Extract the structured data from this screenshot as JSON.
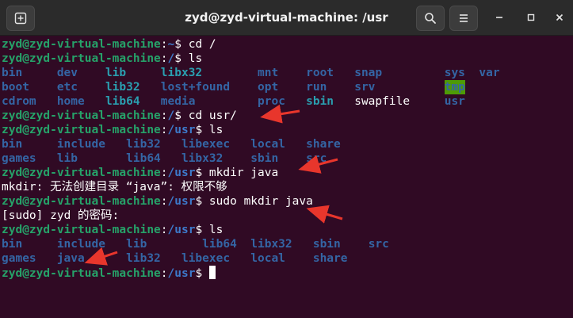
{
  "window": {
    "title": "zyd@zyd-virtual-machine: /usr"
  },
  "colors": {
    "background": "#300a24",
    "prompt_user": "#26a269",
    "prompt_path": "#3d7acb",
    "directory": "#3465a4",
    "directory_cyan": "#2a9fb0",
    "highlight_bg": "#4e9a06",
    "arrow": "#e8362c"
  },
  "terminal": {
    "prompt_user": "zyd@zyd-virtual-machine",
    "prompt_colon": ":",
    "dollar": "$",
    "lines": [
      {
        "type": "prompt",
        "path": "~",
        "command": "cd /"
      },
      {
        "type": "prompt",
        "path": "/",
        "command": "ls"
      },
      {
        "type": "listing",
        "cells": [
          {
            "text": "bin",
            "col": 0,
            "style": "dir"
          },
          {
            "text": "dev",
            "col": 8,
            "style": "dir"
          },
          {
            "text": "lib",
            "col": 15,
            "style": "dir-cyan"
          },
          {
            "text": "libx32",
            "col": 23,
            "style": "dir-cyan"
          },
          {
            "text": "mnt",
            "col": 37,
            "style": "dir"
          },
          {
            "text": "root",
            "col": 44,
            "style": "dir"
          },
          {
            "text": "snap",
            "col": 51,
            "style": "dir"
          },
          {
            "text": "sys",
            "col": 64,
            "style": "dir"
          },
          {
            "text": "var",
            "col": 69,
            "style": "dir"
          }
        ]
      },
      {
        "type": "listing",
        "cells": [
          {
            "text": "boot",
            "col": 0,
            "style": "dir"
          },
          {
            "text": "etc",
            "col": 8,
            "style": "dir"
          },
          {
            "text": "lib32",
            "col": 15,
            "style": "dir-cyan"
          },
          {
            "text": "lost+found",
            "col": 23,
            "style": "dir"
          },
          {
            "text": "opt",
            "col": 37,
            "style": "dir"
          },
          {
            "text": "run",
            "col": 44,
            "style": "dir"
          },
          {
            "text": "srv",
            "col": 51,
            "style": "dir"
          },
          {
            "text": "tmp",
            "col": 64,
            "style": "tmp"
          }
        ]
      },
      {
        "type": "listing",
        "cells": [
          {
            "text": "cdrom",
            "col": 0,
            "style": "dir"
          },
          {
            "text": "home",
            "col": 8,
            "style": "dir"
          },
          {
            "text": "lib64",
            "col": 15,
            "style": "dir-cyan"
          },
          {
            "text": "media",
            "col": 23,
            "style": "dir"
          },
          {
            "text": "proc",
            "col": 37,
            "style": "dir"
          },
          {
            "text": "sbin",
            "col": 44,
            "style": "dir-cyan"
          },
          {
            "text": "swapfile",
            "col": 51,
            "style": "plain"
          },
          {
            "text": "usr",
            "col": 64,
            "style": "dir"
          }
        ]
      },
      {
        "type": "prompt",
        "path": "/",
        "command": "cd usr/"
      },
      {
        "type": "prompt",
        "path": "/usr",
        "command": "ls"
      },
      {
        "type": "listing",
        "cells": [
          {
            "text": "bin",
            "col": 0,
            "style": "dir"
          },
          {
            "text": "include",
            "col": 8,
            "style": "dir"
          },
          {
            "text": "lib32",
            "col": 18,
            "style": "dir"
          },
          {
            "text": "libexec",
            "col": 26,
            "style": "dir"
          },
          {
            "text": "local",
            "col": 36,
            "style": "dir"
          },
          {
            "text": "share",
            "col": 44,
            "style": "dir"
          }
        ]
      },
      {
        "type": "listing",
        "cells": [
          {
            "text": "games",
            "col": 0,
            "style": "dir"
          },
          {
            "text": "lib",
            "col": 8,
            "style": "dir"
          },
          {
            "text": "lib64",
            "col": 18,
            "style": "dir"
          },
          {
            "text": "libx32",
            "col": 26,
            "style": "dir"
          },
          {
            "text": "sbin",
            "col": 36,
            "style": "dir"
          },
          {
            "text": "src",
            "col": 44,
            "style": "dir"
          }
        ]
      },
      {
        "type": "prompt",
        "path": "/usr",
        "command": "mkdir java"
      },
      {
        "type": "text",
        "text": "mkdir: 无法创建目录 “java”: 权限不够"
      },
      {
        "type": "prompt",
        "path": "/usr",
        "command": "sudo mkdir java"
      },
      {
        "type": "text",
        "text": "[sudo] zyd 的密码:"
      },
      {
        "type": "prompt",
        "path": "/usr",
        "command": "ls"
      },
      {
        "type": "listing",
        "cells": [
          {
            "text": "bin",
            "col": 0,
            "style": "dir"
          },
          {
            "text": "include",
            "col": 8,
            "style": "dir"
          },
          {
            "text": "lib",
            "col": 18,
            "style": "dir"
          },
          {
            "text": "lib64",
            "col": 29,
            "style": "dir"
          },
          {
            "text": "libx32",
            "col": 36,
            "style": "dir"
          },
          {
            "text": "sbin",
            "col": 45,
            "style": "dir"
          },
          {
            "text": "src",
            "col": 53,
            "style": "dir"
          }
        ]
      },
      {
        "type": "listing",
        "cells": [
          {
            "text": "games",
            "col": 0,
            "style": "dir"
          },
          {
            "text": "java",
            "col": 8,
            "style": "dir"
          },
          {
            "text": "lib32",
            "col": 18,
            "style": "dir"
          },
          {
            "text": "libexec",
            "col": 26,
            "style": "dir"
          },
          {
            "text": "local",
            "col": 36,
            "style": "dir"
          },
          {
            "text": "share",
            "col": 45,
            "style": "dir"
          }
        ]
      },
      {
        "type": "prompt",
        "path": "/usr",
        "command": "",
        "cursor": true
      }
    ]
  }
}
